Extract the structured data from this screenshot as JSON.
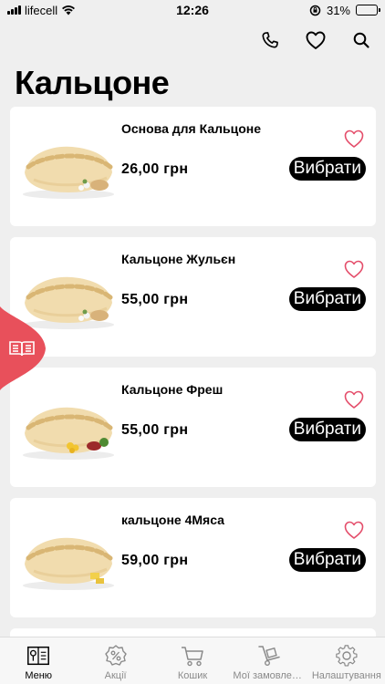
{
  "status": {
    "carrier": "lifecell",
    "time": "12:26",
    "battery": "31%",
    "battery_level": 0.31
  },
  "title": "Кальцоне",
  "products": [
    {
      "name": "Основа для Кальцоне",
      "price": "26,00 грн",
      "button": "Вибрати"
    },
    {
      "name": "Кальцоне Жульєн",
      "price": "55,00 грн",
      "button": "Вибрати"
    },
    {
      "name": "Кальцоне Фреш",
      "price": "55,00 грн",
      "button": "Вибрати"
    },
    {
      "name": "кальцоне 4Мяса",
      "price": "59,00 грн",
      "button": "Вибрати"
    }
  ],
  "tabs": [
    {
      "label": "Меню",
      "icon": "menu-book-icon"
    },
    {
      "label": "Акції",
      "icon": "discount-badge-icon"
    },
    {
      "label": "Кошик",
      "icon": "cart-icon"
    },
    {
      "label": "Мої замовлення",
      "icon": "hand-truck-icon"
    },
    {
      "label": "Налаштування",
      "icon": "gear-icon"
    }
  ],
  "colors": {
    "accent": "#e8505b",
    "heart": "#e44d6a",
    "button": "#000000",
    "background": "#efefef"
  }
}
